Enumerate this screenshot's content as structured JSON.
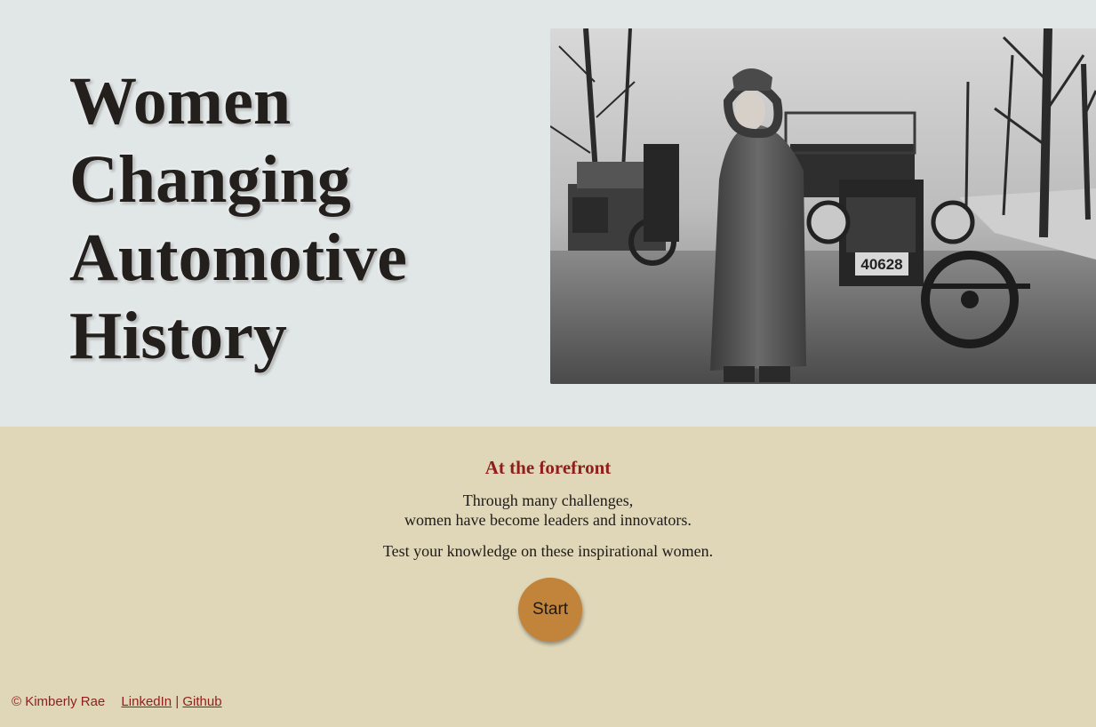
{
  "hero": {
    "title_lines": [
      "Women",
      "Changing",
      "Automotive",
      "History"
    ],
    "image": {
      "description_icon": "photo-woman-with-car",
      "plate_text": "40628"
    }
  },
  "main": {
    "subtitle": "At the forefront",
    "intro_lines": [
      "Through many challenges,",
      "women have become leaders and innovators."
    ],
    "cta_text": "Test your knowledge on these inspirational women.",
    "start_label": "Start"
  },
  "footer": {
    "copyright": "© Kimberly Rae",
    "linkedin_label": "LinkedIn",
    "separator": "|",
    "github_label": "Github"
  },
  "colors": {
    "hero_bg": "#e1e6e6",
    "content_bg": "#e0d7b8",
    "accent": "#8e1f1c",
    "button": "#c2833a",
    "text": "#231f1c"
  }
}
